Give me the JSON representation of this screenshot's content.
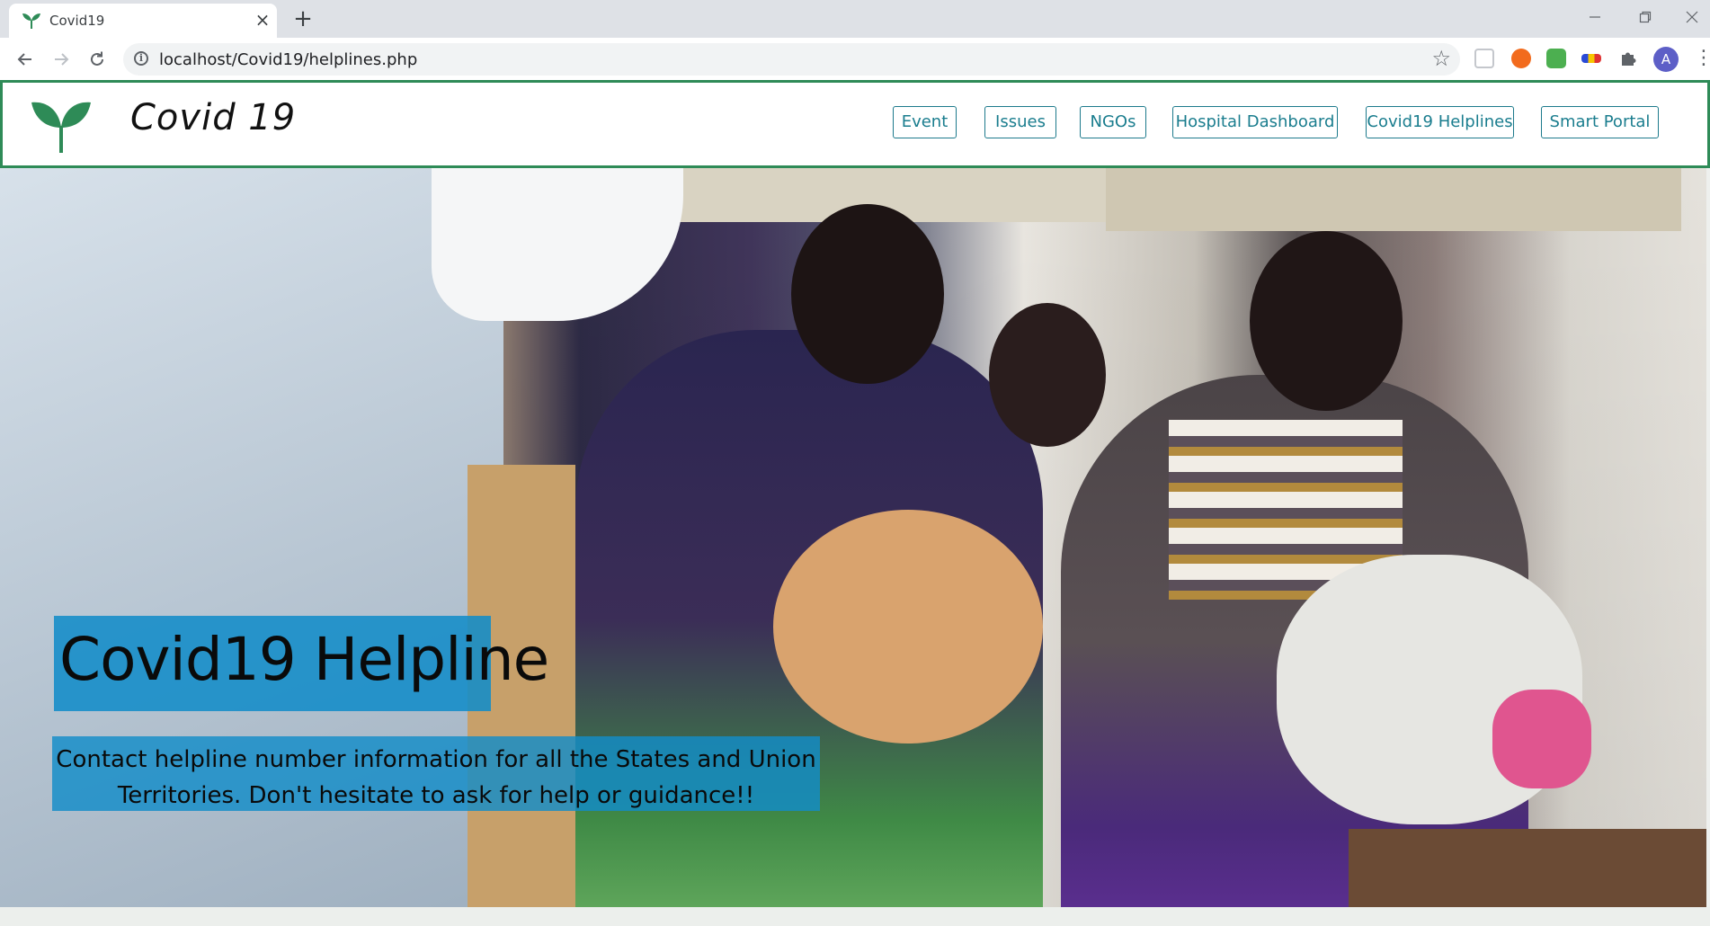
{
  "browser": {
    "tab_title": "Covid19",
    "tab_close": "×",
    "new_tab": "+",
    "url": "localhost/Covid19/helplines.php",
    "avatar_letter": "A",
    "icons": {
      "back": "arrow-left-icon",
      "forward": "arrow-right-icon",
      "reload": "reload-icon",
      "info": "info-icon",
      "bookmark": "star-icon",
      "extensions": "puzzle-icon",
      "menu": "kebab-menu-icon",
      "minimize": "minimize-icon",
      "restore": "restore-icon",
      "close": "close-icon"
    }
  },
  "site": {
    "brand": "Covid 19",
    "accent_color": "#2e8b57",
    "link_color": "#1a7d8e",
    "nav": [
      {
        "label": "Event"
      },
      {
        "label": "Issues"
      },
      {
        "label": "NGOs"
      },
      {
        "label": "Hospital Dashboard"
      },
      {
        "label": "Covid19 Helplines"
      },
      {
        "label": "Smart Portal"
      }
    ]
  },
  "hero": {
    "title": "Covid19 Helpline",
    "subtitle_line1": "Contact helpline number information for all the States and Union",
    "subtitle_line2": "Territories. Don't hesitate to ask for help or guidance!!",
    "overlay_color": "#128cc8"
  }
}
